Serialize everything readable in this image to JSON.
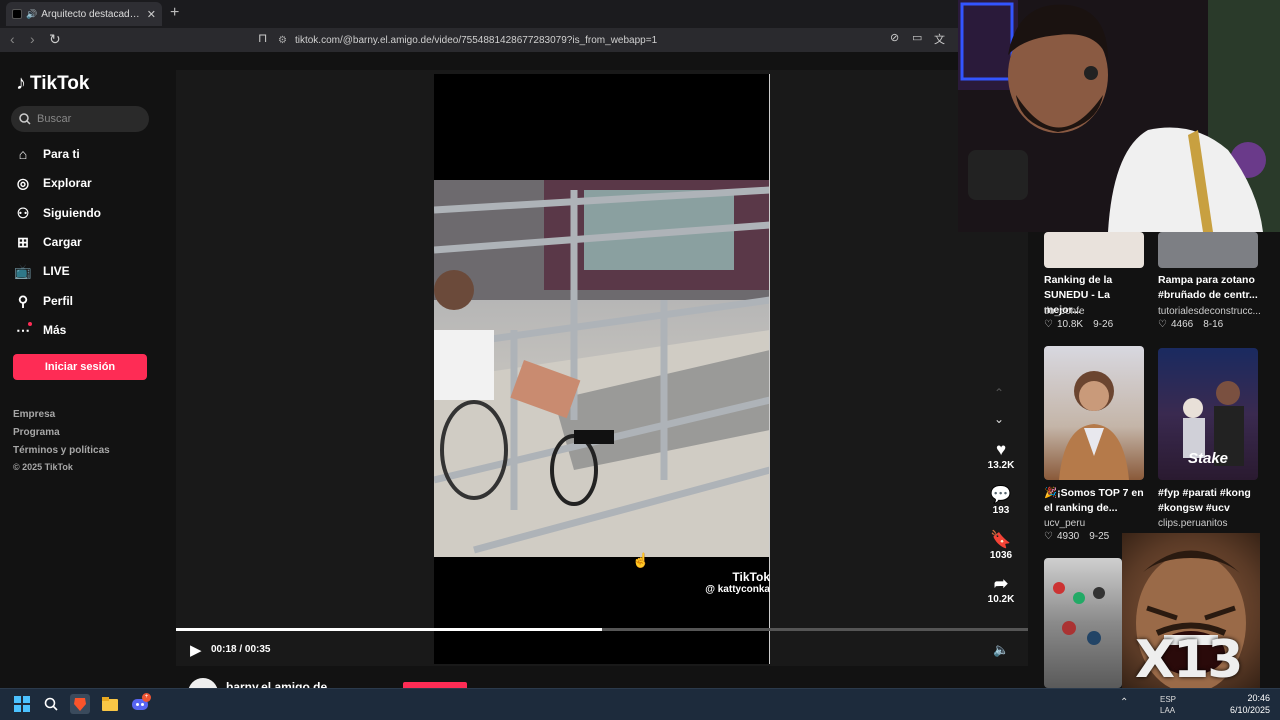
{
  "browser": {
    "tab_title": "Arquitecto destacado de la U",
    "url": "tiktok.com/@barny.el.amigo.de/video/7554881428677283079?is_from_webapp=1"
  },
  "sidebar": {
    "brand": "TikTok",
    "search_placeholder": "Buscar",
    "items": [
      {
        "label": "Para ti",
        "icon": "home-icon"
      },
      {
        "label": "Explorar",
        "icon": "compass-icon"
      },
      {
        "label": "Siguiendo",
        "icon": "following-icon"
      },
      {
        "label": "Cargar",
        "icon": "upload-icon"
      },
      {
        "label": "LIVE",
        "icon": "live-icon"
      },
      {
        "label": "Perfil",
        "icon": "profile-icon"
      },
      {
        "label": "Más",
        "icon": "more-icon"
      }
    ],
    "login_label": "Iniciar sesión",
    "footer": [
      "Empresa",
      "Programa",
      "Términos y políticas",
      "© 2025 TikTok"
    ]
  },
  "video": {
    "watermark_logo": "TikTok",
    "watermark_user": "@ kattyconka",
    "time": "00:18 / 00:35",
    "progress": 0.5,
    "author": "barny.el.amigo.de"
  },
  "actions": {
    "likes": "13.2K",
    "comments": "193",
    "saves": "1036",
    "shares": "10.2K"
  },
  "recommended": [
    {
      "title": "Ranking de la SUNEDU - La mejor...",
      "author": "tio_confe",
      "likes": "10.8K",
      "date": "9-26"
    },
    {
      "title": "Rampa para zotano #bruñado de centr...",
      "author": "tutorialesdeconstrucc...",
      "likes": "4466",
      "date": "8-16"
    },
    {
      "title": "🎉¡Somos TOP 7 en el ranking de...",
      "author": "ucv_peru",
      "likes": "4930",
      "date": "9-25"
    },
    {
      "title": "#fyp #parati #kong #kongsw #ucv",
      "author": "clips.peruanitos",
      "likes": "",
      "date": ""
    }
  ],
  "overlay": {
    "meme_label": "X13",
    "thumb_caption": "Stake"
  },
  "taskbar": {
    "lang_top": "ESP",
    "lang_bottom": "LAA",
    "time": "20:46",
    "date": "6/10/2025"
  }
}
